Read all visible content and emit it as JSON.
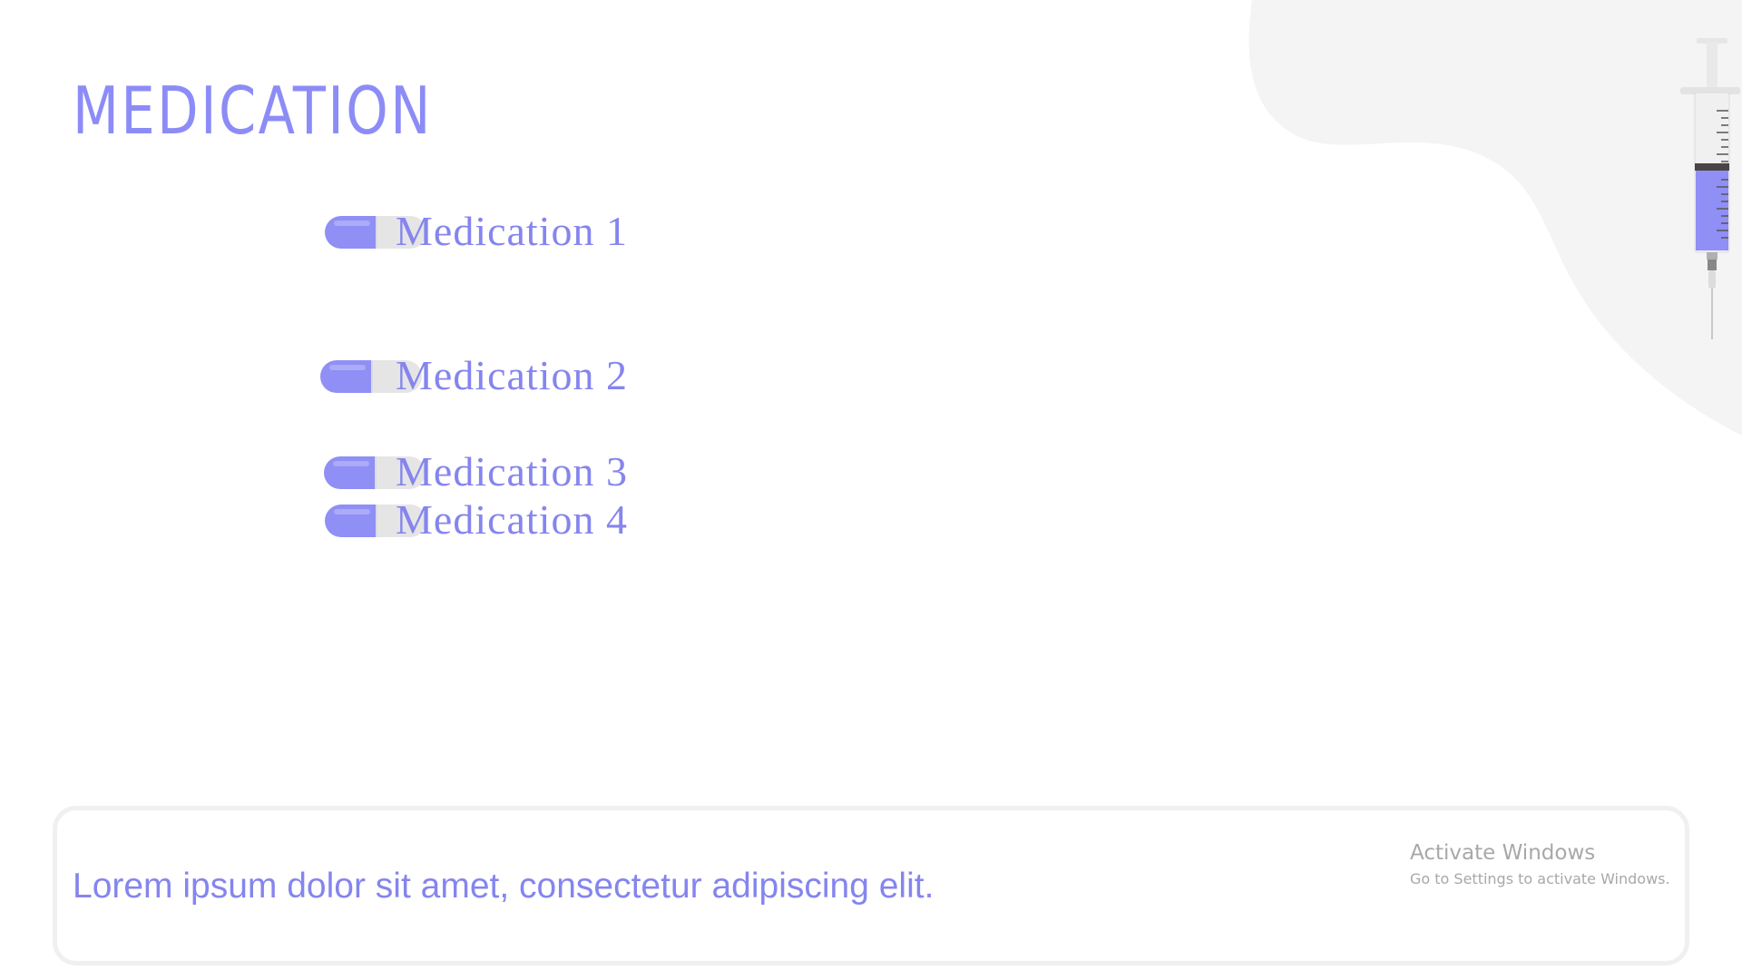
{
  "slide": {
    "title": "MEDICATION",
    "medications": [
      {
        "label": "Medication 1"
      },
      {
        "label": "Medication 2"
      },
      {
        "label": "Medication 3"
      },
      {
        "label": "Medication 4"
      }
    ],
    "body_text": "Lorem ipsum dolor sit amet, consectetur adipiscing elit.",
    "icons": {
      "pill": "pill-icon",
      "syringe": "syringe-icon"
    }
  },
  "overlay": {
    "activate_title": "Activate Windows",
    "activate_subtitle": "Go to Settings to activate Windows."
  },
  "colors": {
    "accent": "#8c8cf7",
    "pill_left": "#8f8ff5",
    "pill_right": "#e2e2e2",
    "blob": "#f4f4f4"
  }
}
